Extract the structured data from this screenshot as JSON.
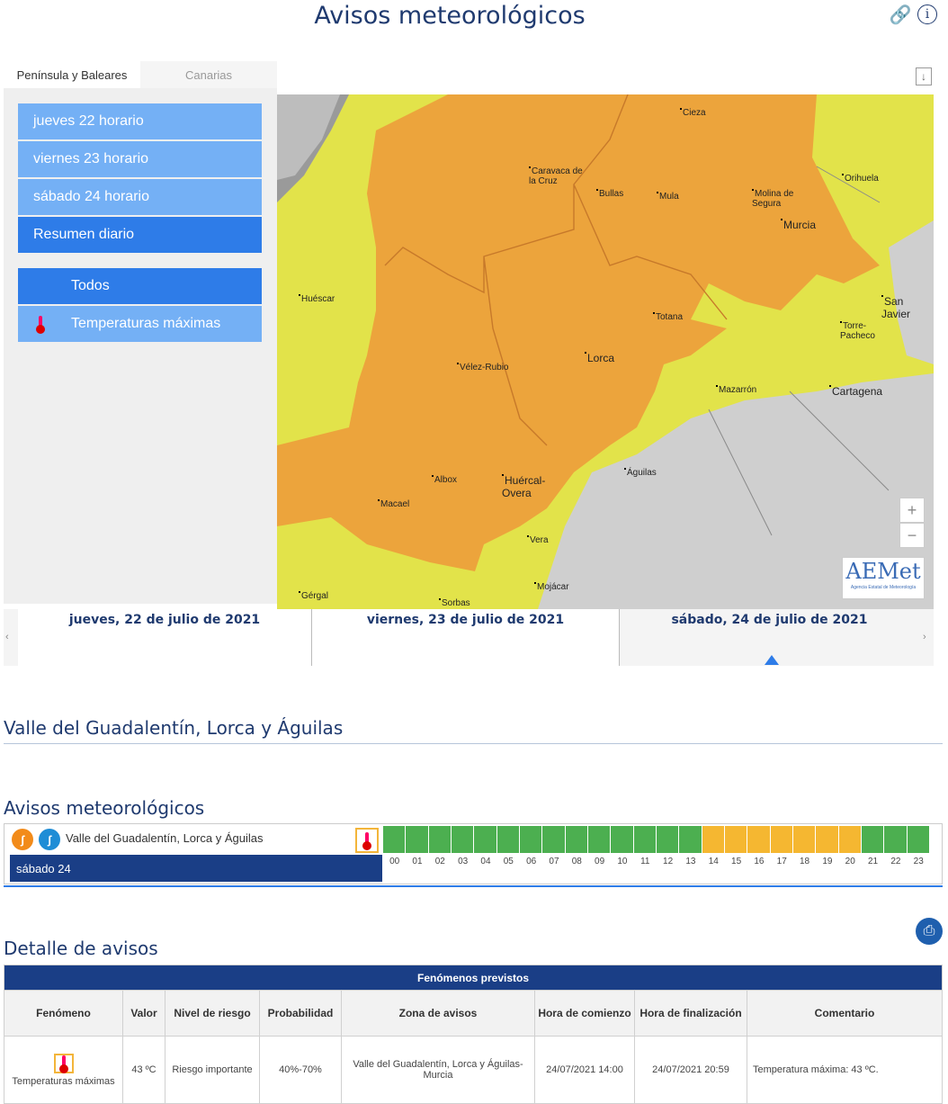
{
  "page": {
    "title": "Avisos meteorológicos"
  },
  "sidebar": {
    "tabs": [
      "Península y Baleares",
      "Canarias"
    ],
    "days": [
      "jueves 22 horario",
      "viernes 23 horario",
      "sábado 24 horario",
      "Resumen diario"
    ],
    "filters": [
      "Todos",
      "Temperaturas máximas"
    ]
  },
  "map": {
    "towns": [
      {
        "name": "Cieza"
      },
      {
        "name": "Orihuela"
      },
      {
        "name": "Caravaca de la Cruz"
      },
      {
        "name": "Bullas"
      },
      {
        "name": "Mula"
      },
      {
        "name": "Molina de Segura"
      },
      {
        "name": "Murcia"
      },
      {
        "name": "San Javier"
      },
      {
        "name": "Huéscar"
      },
      {
        "name": "Totana"
      },
      {
        "name": "Torre-Pacheco"
      },
      {
        "name": "Lorca"
      },
      {
        "name": "Vélez-Rubio"
      },
      {
        "name": "Mazarrón"
      },
      {
        "name": "Cartagena"
      },
      {
        "name": "Águilas"
      },
      {
        "name": "Albox"
      },
      {
        "name": "Huércal-Overa"
      },
      {
        "name": "Macael"
      },
      {
        "name": "Vera"
      },
      {
        "name": "Mojácar"
      },
      {
        "name": "Gérgal"
      },
      {
        "name": "Sorbas"
      }
    ],
    "logo_text": "AEMet",
    "logo_sub": "Agencia Estatal de Meteorología"
  },
  "dates": [
    "jueves, 22 de julio de 2021",
    "viernes, 23 de julio de 2021",
    "sábado, 24 de julio de 2021"
  ],
  "zone_title": "Valle del Guadalentín, Lorca y Águilas",
  "warnings": {
    "title": "Avisos meteorológicos",
    "zone": "Valle del Guadalentín, Lorca y Águilas",
    "day": "sábado 24",
    "hours": [
      "00",
      "01",
      "02",
      "03",
      "04",
      "05",
      "06",
      "07",
      "08",
      "09",
      "10",
      "11",
      "12",
      "13",
      "14",
      "15",
      "16",
      "17",
      "18",
      "19",
      "20",
      "21",
      "22",
      "23"
    ],
    "levels": [
      "green",
      "green",
      "green",
      "green",
      "green",
      "green",
      "green",
      "green",
      "green",
      "green",
      "green",
      "green",
      "green",
      "green",
      "yellow",
      "yellow",
      "yellow",
      "yellow",
      "yellow",
      "yellow",
      "yellow",
      "green",
      "green",
      "green"
    ],
    "colors": {
      "green": "#4caf50",
      "yellow": "#f5b731"
    }
  },
  "detail": {
    "title": "Detalle de avisos",
    "band": "Fenómenos previstos",
    "headers": [
      "Fenómeno",
      "Valor",
      "Nivel de riesgo",
      "Probabilidad",
      "Zona de avisos",
      "Hora de comienzo",
      "Hora de finalización",
      "Comentario"
    ],
    "row": {
      "fenomeno": "Temperaturas máximas",
      "valor": "43 ºC",
      "nivel": "Riesgo importante",
      "probabilidad": "40%-70%",
      "zona": "Valle del Guadalentín, Lorca y Águilas-Murcia",
      "comienzo": "24/07/2021 14:00",
      "fin": "24/07/2021 20:59",
      "comentario": "Temperatura máxima: 43 ºC."
    }
  }
}
